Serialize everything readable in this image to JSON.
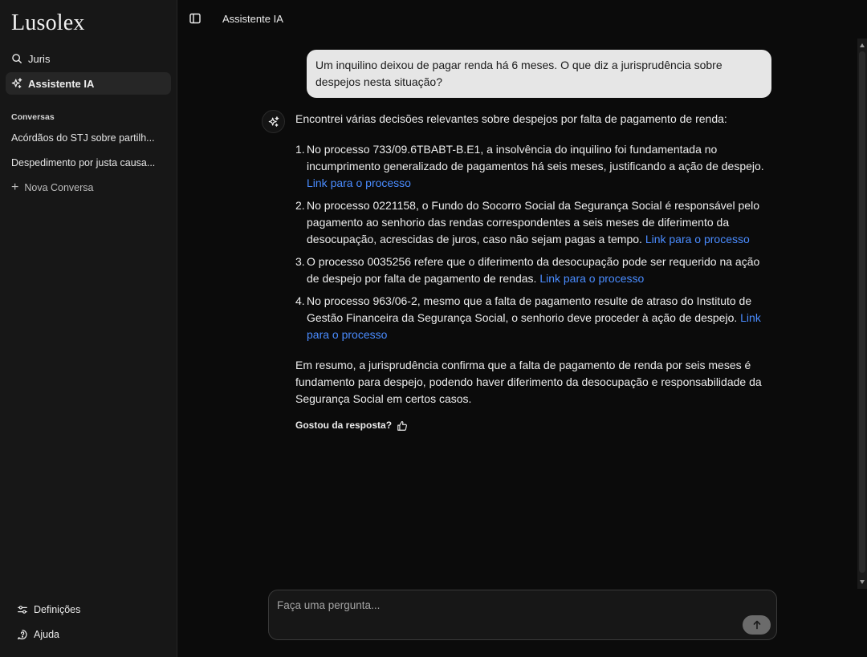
{
  "sidebar": {
    "brand": "Lusolex",
    "nav": [
      {
        "label": "Juris",
        "icon": "search-icon",
        "active": false
      },
      {
        "label": "Assistente IA",
        "icon": "sparkles-icon",
        "active": true
      }
    ],
    "section_label": "Conversas",
    "conversations": [
      "Acórdãos do STJ sobre partilh...",
      "Despedimento por justa causa..."
    ],
    "new_conversation": "Nova Conversa",
    "bottom": [
      {
        "label": "Definições",
        "icon": "settings-icon"
      },
      {
        "label": "Ajuda",
        "icon": "help-icon"
      }
    ]
  },
  "topbar": {
    "title": "Assistente IA"
  },
  "chat": {
    "user_message": "Um inquilino deixou de pagar renda há 6 meses. O que diz a jurisprudência sobre despejos nesta situação?",
    "bot": {
      "intro": "Encontrei várias decisões relevantes sobre despejos por falta de pagamento de renda:",
      "items": [
        {
          "num": "1.",
          "text": "No processo 733/09.6TBABT-B.E1, a insolvência do inquilino foi fundamentada no incumprimento generalizado de pagamentos há seis meses, justificando a ação de despejo.",
          "link": "Link para o processo"
        },
        {
          "num": "2.",
          "text": "No processo 0221158, o Fundo do Socorro Social da Segurança Social é responsável pelo pagamento ao senhorio das rendas correspondentes a seis meses de diferimento da desocupação, acrescidas de juros, caso não sejam pagas a tempo.",
          "link": "Link para o processo"
        },
        {
          "num": "3.",
          "text": "O processo 0035256 refere que o diferimento da desocupação pode ser requerido na ação de despejo por falta de pagamento de rendas.",
          "link": "Link para o processo"
        },
        {
          "num": "4.",
          "text": "No processo 963/06-2, mesmo que a falta de pagamento resulte de atraso do Instituto de Gestão Financeira da Segurança Social, o senhorio deve proceder à ação de despejo.",
          "link": "Link para o processo"
        }
      ],
      "summary": "Em resumo, a jurisprudência confirma que a falta de pagamento de renda por seis meses é fundamento para despejo, podendo haver diferimento da desocupação e responsabilidade da Segurança Social em certos casos.",
      "feedback_label": "Gostou da resposta?"
    }
  },
  "composer": {
    "placeholder": "Faça uma pergunta..."
  }
}
